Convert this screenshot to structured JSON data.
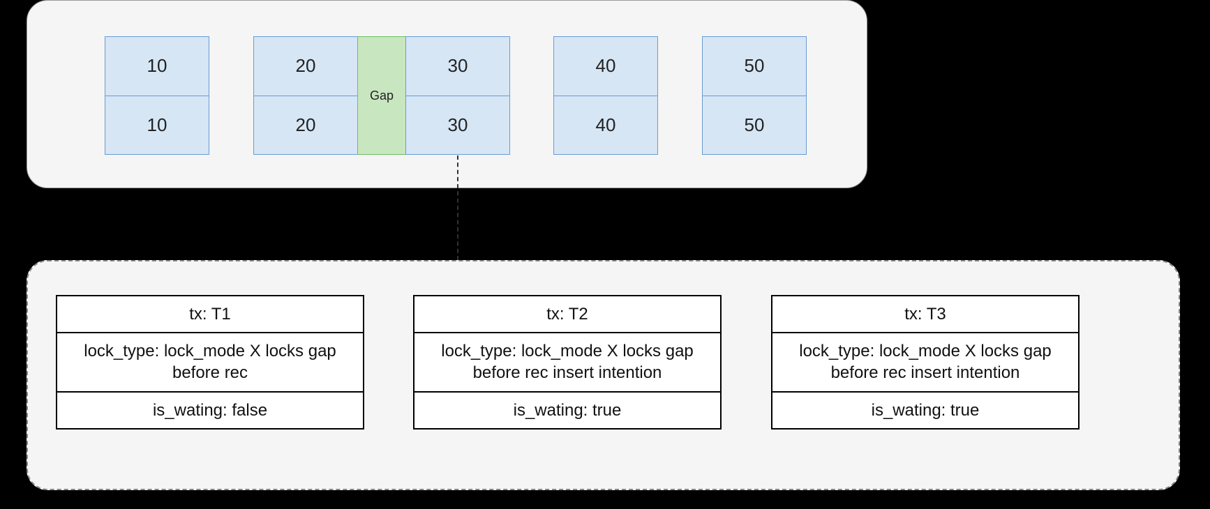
{
  "records": [
    {
      "top": "10",
      "bottom": "10"
    },
    {
      "top": "20",
      "bottom": "20"
    },
    {
      "top": "30",
      "bottom": "30"
    },
    {
      "top": "40",
      "bottom": "40"
    },
    {
      "top": "50",
      "bottom": "50"
    }
  ],
  "gap_label": "Gap",
  "locks": [
    {
      "tx": "tx: T1",
      "lock_type": "lock_type: lock_mode X locks gap before rec",
      "is_waiting": "is_wating: false"
    },
    {
      "tx": "tx: T2",
      "lock_type": "lock_type: lock_mode X locks gap before rec insert intention",
      "is_waiting": "is_wating: true"
    },
    {
      "tx": "tx: T3",
      "lock_type": "lock_type: lock_mode X locks gap before rec insert intention",
      "is_waiting": "is_wating: true"
    }
  ]
}
